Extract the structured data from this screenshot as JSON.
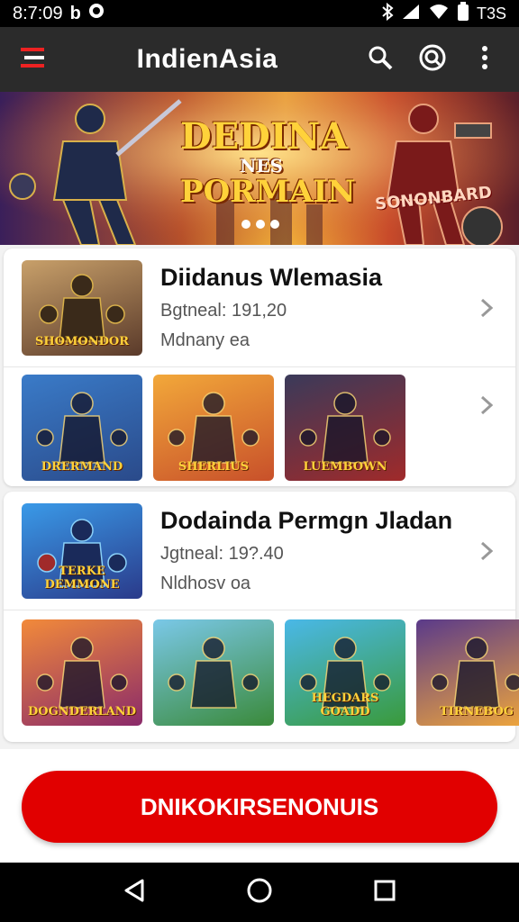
{
  "status_bar": {
    "time": "8:7:09",
    "left_icons": [
      "b-icon",
      "chat-bubble-icon"
    ],
    "right_text": "T3S"
  },
  "app_bar": {
    "title": "IndienAsia"
  },
  "hero": {
    "title_line1": "DEDINA",
    "title_line2": "NES",
    "title_line3": "PORMAIN",
    "badge": "SONONBARD",
    "active_dot": 0,
    "dot_count": 3
  },
  "cards": [
    {
      "title": "Diidanus Wlemasia",
      "meta": "Bgtneal: 191,20",
      "sub": "Mdnany ea",
      "thumb_label": "SHOMONDOR",
      "tiles": [
        {
          "label": "DRERMAND",
          "colors": [
            "#3a7bc8",
            "#2a4a8a"
          ]
        },
        {
          "label": "SHERLIUS",
          "colors": [
            "#f2a83a",
            "#c8502a"
          ]
        },
        {
          "label": "LUEMBOWN",
          "colors": [
            "#3a3a5a",
            "#a02a2a"
          ]
        }
      ]
    },
    {
      "title": "Dodaindа Permgn Jladan",
      "meta": "Jgtneal: 19?.40",
      "sub": "Nldhosv oa",
      "thumb_label": "TERKE DEMMONE",
      "tiles": [
        {
          "label": "DOGNDERLAND",
          "colors": [
            "#f28a3a",
            "#8a2a6a"
          ]
        },
        {
          "label": "",
          "colors": [
            "#7ac8e8",
            "#3a8a3a"
          ]
        },
        {
          "label": "HEGDARS GOADD",
          "colors": [
            "#4ab8e8",
            "#3a9a3a"
          ]
        },
        {
          "label": "TIRNEBOG",
          "colors": [
            "#5a3a8a",
            "#f2a83a"
          ]
        }
      ]
    }
  ],
  "cta": {
    "label": "DNIKOKIRSENONUIS"
  },
  "colors": {
    "accent": "#e10000",
    "app_bar": "#2b2b2b"
  }
}
